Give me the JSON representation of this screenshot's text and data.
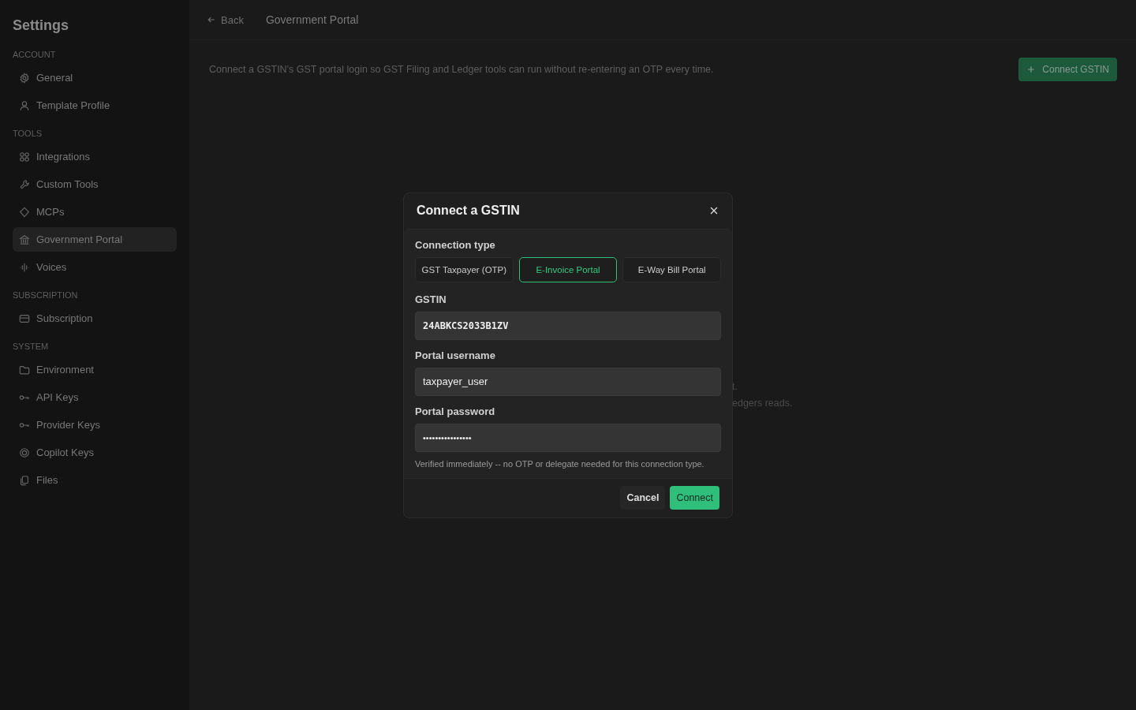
{
  "sidebar": {
    "title": "Settings",
    "sections": [
      {
        "heading": "ACCOUNT",
        "items": [
          {
            "label": "General",
            "kind": "gear",
            "selected": false
          },
          {
            "label": "Template Profile",
            "kind": "person",
            "selected": false
          }
        ]
      },
      {
        "heading": "TOOLS",
        "items": [
          {
            "label": "Integrations",
            "kind": "grid",
            "selected": false
          },
          {
            "label": "Custom Tools",
            "kind": "wrench",
            "selected": false
          },
          {
            "label": "MCPs",
            "kind": "diamond",
            "selected": false
          },
          {
            "label": "Government Portal",
            "kind": "bank",
            "selected": true
          },
          {
            "label": "Voices",
            "kind": "wave",
            "selected": false
          }
        ]
      },
      {
        "heading": "SUBSCRIPTION",
        "items": [
          {
            "label": "Subscription",
            "kind": "card",
            "selected": false
          }
        ]
      },
      {
        "heading": "SYSTEM",
        "items": [
          {
            "label": "Environment",
            "kind": "folder",
            "selected": false
          },
          {
            "label": "API Keys",
            "kind": "key",
            "selected": false
          },
          {
            "label": "Provider Keys",
            "kind": "key",
            "selected": false
          },
          {
            "label": "Copilot Keys",
            "kind": "target",
            "selected": false
          },
          {
            "label": "Files",
            "kind": "files",
            "selected": false
          }
        ]
      }
    ]
  },
  "header": {
    "back": "Back",
    "title": "Government Portal"
  },
  "description": "Connect a GSTIN's GST portal login so GST Filing and Ledger tools can run without re-entering an OTP every time.",
  "connect_button": "Connect GSTIN",
  "hidden_note_fragments": [
    "t.",
    "edgers reads."
  ],
  "dialog": {
    "title": "Connect a GSTIN",
    "connection_type_label": "Connection type",
    "connection_types": [
      {
        "label": "GST Taxpayer (OTP)",
        "selected": false
      },
      {
        "label": "E-Invoice Portal",
        "selected": true
      },
      {
        "label": "E-Way Bill Portal",
        "selected": false
      }
    ],
    "fields": [
      {
        "label": "GSTIN",
        "value": "24ABKCS2033B1ZV",
        "kind": "mono"
      },
      {
        "label": "Portal username",
        "value": "taxpayer_user",
        "kind": "text"
      },
      {
        "label": "Portal password",
        "value": "••••••••••••••••",
        "kind": "password"
      }
    ],
    "hint": "Verified immediately -- no OTP or delegate needed for this connection type.",
    "cancel": "Cancel",
    "confirm": "Connect"
  }
}
